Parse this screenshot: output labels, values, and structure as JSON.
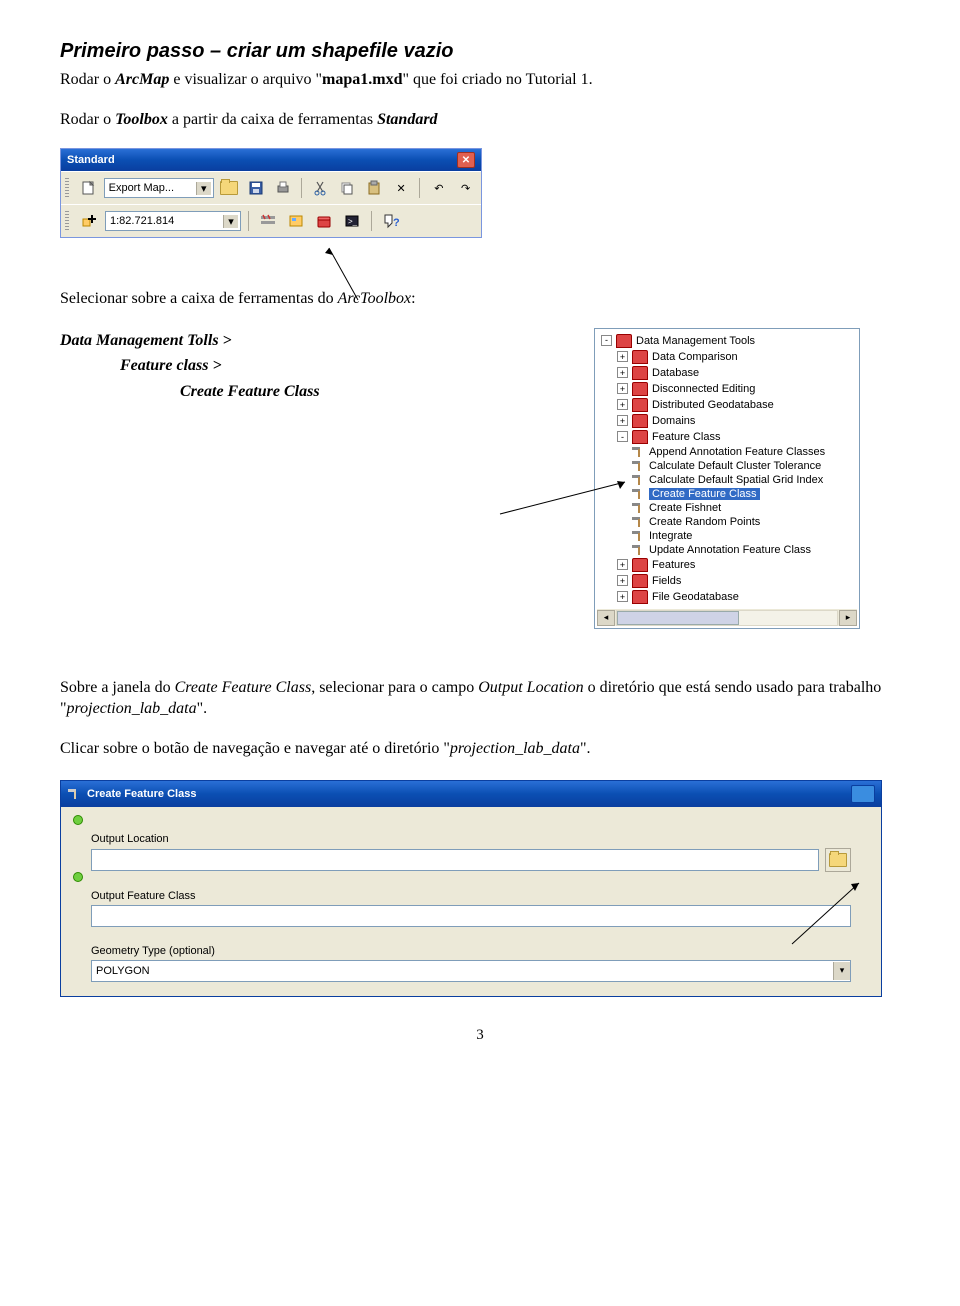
{
  "heading": "Primeiro passo – criar um shapefile vazio",
  "para1_pre": "Rodar o ",
  "para1_em1": "ArcMap",
  "para1_mid": " e visualizar o arquivo \"",
  "para1_bold": "mapa1.mxd",
  "para1_post": "\" que foi criado no Tutorial 1.",
  "para2_pre": "Rodar o ",
  "para2_em1": "Toolbox",
  "para2_mid": " a partir da caixa de ferramentas ",
  "para2_em2": "Standard",
  "toolbar": {
    "title": "Standard",
    "export_label": "Export Map...",
    "scale": "1:82.721.814"
  },
  "para3_pre": "Selecionar sobre a caixa de ferramentas do ",
  "para3_em": "ArcToolbox",
  "para3_post": ":",
  "path1": "Data Management Tolls >",
  "path2": "Feature class >",
  "path3": "Create Feature Class",
  "tree": {
    "root": "Data Management Tools",
    "items": [
      "Data Comparison",
      "Database",
      "Disconnected Editing",
      "Distributed Geodatabase",
      "Domains",
      "Feature Class"
    ],
    "sub": [
      "Append Annotation Feature Classes",
      "Calculate Default Cluster Tolerance",
      "Calculate Default Spatial Grid Index",
      "Create Feature Class",
      "Create Fishnet",
      "Create Random Points",
      "Integrate",
      "Update Annotation Feature Class"
    ],
    "after": [
      "Features",
      "Fields",
      "File Geodatabase"
    ]
  },
  "para4_pre": "Sobre a janela do ",
  "para4_em1": "Create Feature Class",
  "para4_mid1": ", selecionar para o campo ",
  "para4_em2": "Output Location",
  "para4_mid2": " o diretório que está sendo usado para trabalho \"",
  "para4_em3": "projection_lab_data",
  "para4_post": "\".",
  "para5_pre": "Clicar sobre o botão de navegação e navegar até o diretório \"",
  "para5_em": "projection_lab_data",
  "para5_post": "\".",
  "dialog": {
    "title": "Create Feature Class",
    "fld1": "Output Location",
    "fld2": "Output Feature Class",
    "fld3": "Geometry Type (optional)",
    "geom_value": "POLYGON"
  },
  "page": "3"
}
